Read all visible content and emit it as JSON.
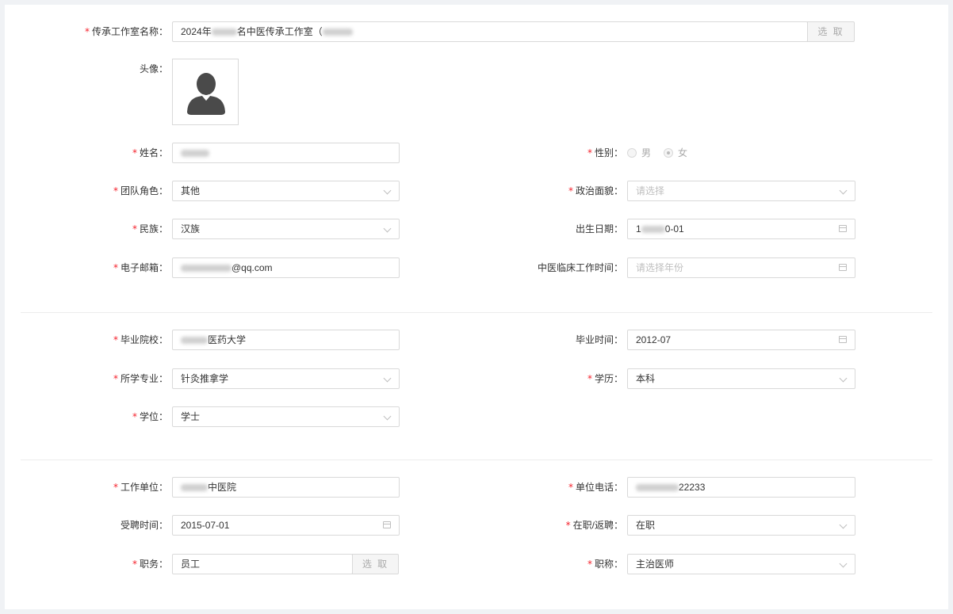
{
  "studio": {
    "label": "传承工作室名称：",
    "value_prefix": "2024年",
    "value_mid": "名中医传承工作室（",
    "pick_label": "选 取"
  },
  "avatar": {
    "label": "头像："
  },
  "name": {
    "label": "姓名："
  },
  "gender": {
    "label": "性别：",
    "options": [
      "男",
      "女"
    ],
    "selected": "女"
  },
  "team_role": {
    "label": "团队角色：",
    "value": "其他"
  },
  "political": {
    "label": "政治面貌：",
    "placeholder": "请选择"
  },
  "ethnicity": {
    "label": "民族：",
    "value": "汉族"
  },
  "birth": {
    "label": "出生日期：",
    "value_prefix": "1",
    "value_suffix": "0-01"
  },
  "email": {
    "label": "电子邮箱：",
    "value_suffix": "@qq.com"
  },
  "tcm_time": {
    "label": "中医临床工作时间：",
    "placeholder": "请选择年份"
  },
  "school": {
    "label": "毕业院校：",
    "value_suffix": "医药大学"
  },
  "grad_time": {
    "label": "毕业时间：",
    "value": "2012-07"
  },
  "major": {
    "label": "所学专业：",
    "value": "针灸推拿学"
  },
  "education": {
    "label": "学历：",
    "value": "本科"
  },
  "degree": {
    "label": "学位：",
    "value": "学士"
  },
  "employer": {
    "label": "工作单位：",
    "value_suffix": "中医院"
  },
  "unit_phone": {
    "label": "单位电话：",
    "value_suffix": "22233"
  },
  "hire_time": {
    "label": "受聘时间：",
    "value": "2015-07-01"
  },
  "status": {
    "label": "在职/返聘：",
    "value": "在职"
  },
  "position": {
    "label": "职务：",
    "value": "员工",
    "pick_label": "选 取"
  },
  "title": {
    "label": "职称：",
    "value": "主治医师"
  },
  "colors": {
    "required": "#f5222d",
    "border": "#d9d9d9",
    "placeholder": "#bfbfbf"
  },
  "icons": {
    "avatar": "user-silhouette-icon",
    "calendar": "calendar-icon",
    "chevron": "chevron-down-icon"
  }
}
